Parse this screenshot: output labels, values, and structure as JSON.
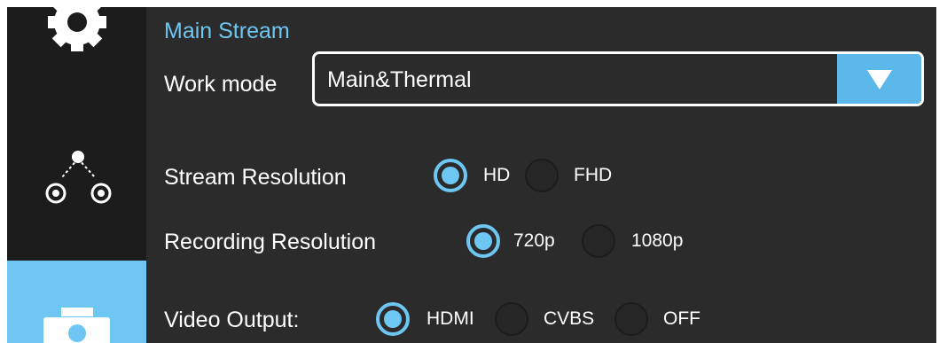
{
  "sidebar": {
    "items": [
      {
        "icon": "gear-icon",
        "active": false
      },
      {
        "icon": "network-nodes-icon",
        "active": false
      },
      {
        "icon": "camera-icon",
        "active": true
      }
    ]
  },
  "colors": {
    "accent": "#6ec6f2",
    "dropdown_button": "#5cb7ea",
    "sidebar_bg": "#1c1c1c",
    "panel_bg": "#2b2b2b"
  },
  "main": {
    "section_title": "Main Stream",
    "work_mode": {
      "label": "Work mode",
      "value": "Main&Thermal",
      "icon": "triangle-down-icon"
    },
    "stream_resolution": {
      "label": "Stream Resolution",
      "options": [
        "HD",
        "FHD"
      ],
      "selected": "HD"
    },
    "recording_resolution": {
      "label": "Recording Resolution",
      "options": [
        "720p",
        "1080p"
      ],
      "selected": "720p"
    },
    "video_output": {
      "label": "Video Output:",
      "options": [
        "HDMI",
        "CVBS",
        "OFF"
      ],
      "selected": "HDMI"
    }
  }
}
